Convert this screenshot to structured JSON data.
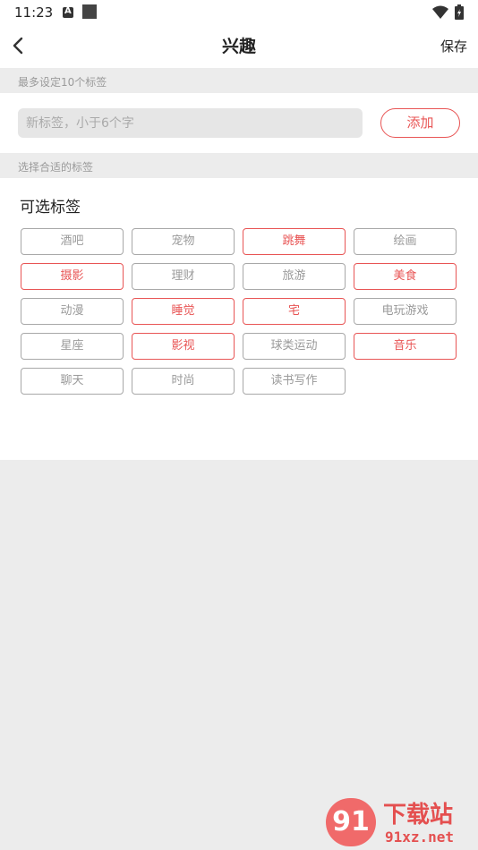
{
  "status_bar": {
    "time": "11:23"
  },
  "header": {
    "title": "兴趣",
    "save_label": "保存"
  },
  "hints": {
    "max_tags": "最多设定10个标签",
    "choose_tags": "选择合适的标签"
  },
  "input": {
    "value": "",
    "placeholder": "新标签，小于6个字",
    "add_label": "添加"
  },
  "tags_section": {
    "title": "可选标签",
    "tags": [
      {
        "label": "酒吧",
        "selected": false
      },
      {
        "label": "宠物",
        "selected": false
      },
      {
        "label": "跳舞",
        "selected": true
      },
      {
        "label": "绘画",
        "selected": false
      },
      {
        "label": "摄影",
        "selected": true
      },
      {
        "label": "理财",
        "selected": false
      },
      {
        "label": "旅游",
        "selected": false
      },
      {
        "label": "美食",
        "selected": true
      },
      {
        "label": "动漫",
        "selected": false
      },
      {
        "label": "睡觉",
        "selected": true
      },
      {
        "label": "宅",
        "selected": true
      },
      {
        "label": "电玩游戏",
        "selected": false
      },
      {
        "label": "星座",
        "selected": false
      },
      {
        "label": "影视",
        "selected": true
      },
      {
        "label": "球类运动",
        "selected": false
      },
      {
        "label": "音乐",
        "selected": true
      },
      {
        "label": "聊天",
        "selected": false
      },
      {
        "label": "时尚",
        "selected": false
      },
      {
        "label": "读书写作",
        "selected": false
      }
    ]
  },
  "watermark": {
    "badge": "91",
    "title": "下载站",
    "url": "91xz.net"
  },
  "colors": {
    "accent": "#e85555",
    "background": "#ececec",
    "unselected_border": "#a8a8a8"
  },
  "icons": [
    "notification-a-icon",
    "app-square-icon",
    "wifi-icon",
    "battery-icon",
    "back-icon"
  ]
}
